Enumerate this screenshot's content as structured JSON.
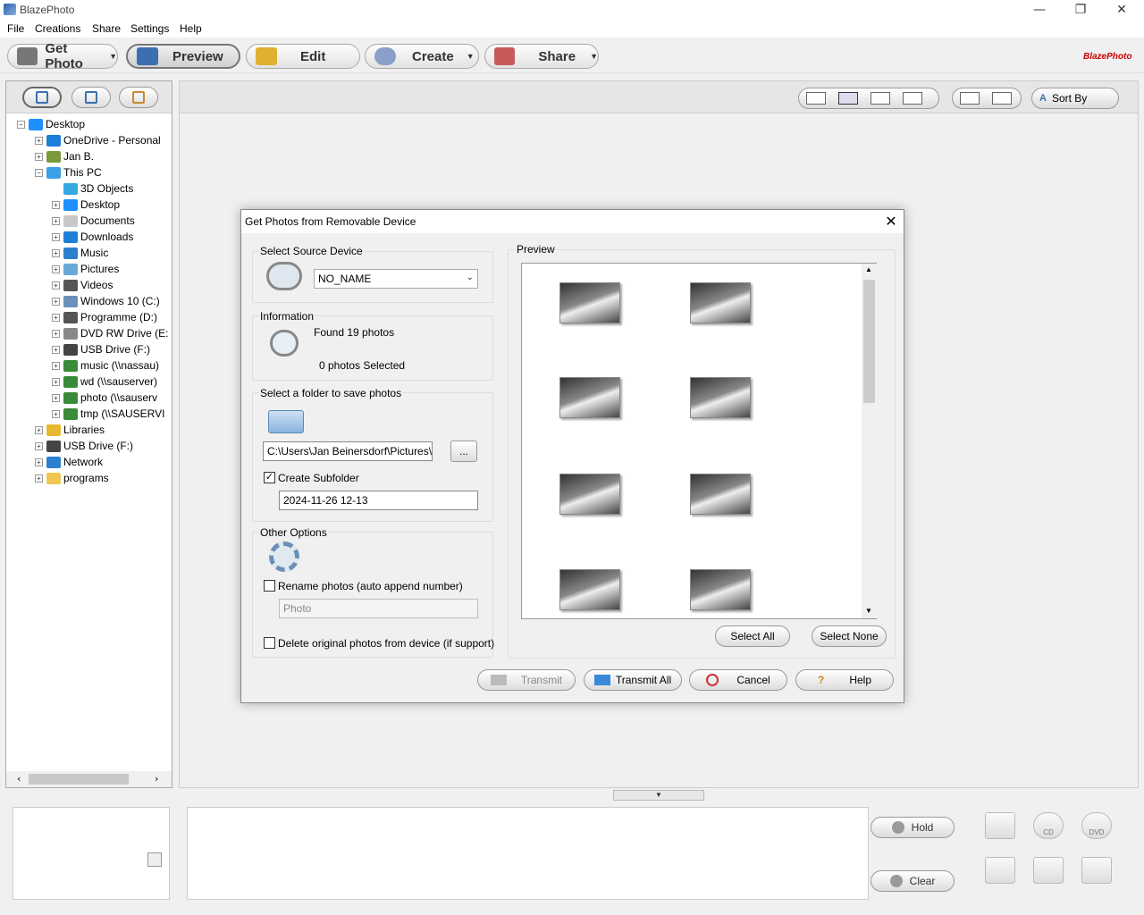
{
  "window": {
    "title": "BlazePhoto",
    "minimize": "—",
    "maximize": "❐",
    "close": "✕"
  },
  "menu": [
    "File",
    "Creations",
    "Share",
    "Settings",
    "Help"
  ],
  "toolbar": {
    "get_photo": "Get Photo",
    "preview": "Preview",
    "edit": "Edit",
    "create": "Create",
    "share": "Share",
    "dropdown_glyph": "▼",
    "logo": "BlazePhoto"
  },
  "tree": [
    {
      "label": "Desktop",
      "level": 0,
      "exp": "−",
      "icon": "desktop-icon",
      "color": "#1e90ff"
    },
    {
      "label": "OneDrive - Personal",
      "level": 1,
      "exp": "+",
      "icon": "cloud-icon",
      "color": "#1e7fd8"
    },
    {
      "label": "Jan B.",
      "level": 1,
      "exp": "+",
      "icon": "user-icon",
      "color": "#7a9a3a"
    },
    {
      "label": "This PC",
      "level": 1,
      "exp": "−",
      "icon": "computer-icon",
      "color": "#3aa0e8"
    },
    {
      "label": "3D Objects",
      "level": 2,
      "exp": "",
      "icon": "cube-icon",
      "color": "#35a8e0"
    },
    {
      "label": "Desktop",
      "level": 2,
      "exp": "+",
      "icon": "desktop-icon",
      "color": "#1e90ff"
    },
    {
      "label": "Documents",
      "level": 2,
      "exp": "+",
      "icon": "document-icon",
      "color": "#c8c8c8"
    },
    {
      "label": "Downloads",
      "level": 2,
      "exp": "+",
      "icon": "download-icon",
      "color": "#1e7fd8"
    },
    {
      "label": "Music",
      "level": 2,
      "exp": "+",
      "icon": "music-icon",
      "color": "#2d7fd0"
    },
    {
      "label": "Pictures",
      "level": 2,
      "exp": "+",
      "icon": "pictures-icon",
      "color": "#6aa8d8"
    },
    {
      "label": "Videos",
      "level": 2,
      "exp": "+",
      "icon": "video-icon",
      "color": "#555555"
    },
    {
      "label": "Windows 10 (C:)",
      "level": 2,
      "exp": "+",
      "icon": "drive-icon",
      "color": "#6a8fb8"
    },
    {
      "label": "Programme (D:)",
      "level": 2,
      "exp": "+",
      "icon": "drive-icon",
      "color": "#555555"
    },
    {
      "label": "DVD RW Drive (E:",
      "level": 2,
      "exp": "+",
      "icon": "dvd-drive-icon",
      "color": "#888888"
    },
    {
      "label": "USB Drive (F:)",
      "level": 2,
      "exp": "+",
      "icon": "usb-drive-icon",
      "color": "#444444"
    },
    {
      "label": "music (\\\\nassau)",
      "level": 2,
      "exp": "+",
      "icon": "network-drive-icon",
      "color": "#3a8a3a"
    },
    {
      "label": "wd (\\\\sauserver)",
      "level": 2,
      "exp": "+",
      "icon": "network-drive-icon",
      "color": "#3a8a3a"
    },
    {
      "label": "photo (\\\\sauserv",
      "level": 2,
      "exp": "+",
      "icon": "network-drive-icon",
      "color": "#3a8a3a"
    },
    {
      "label": "tmp (\\\\SAUSERVI",
      "level": 2,
      "exp": "+",
      "icon": "network-drive-icon",
      "color": "#3a8a3a"
    },
    {
      "label": "Libraries",
      "level": 1,
      "exp": "+",
      "icon": "library-icon",
      "color": "#e8b830"
    },
    {
      "label": "USB Drive (F:)",
      "level": 1,
      "exp": "+",
      "icon": "usb-drive-icon",
      "color": "#444444"
    },
    {
      "label": "Network",
      "level": 1,
      "exp": "+",
      "icon": "network-icon",
      "color": "#2d7fd0"
    },
    {
      "label": "programs",
      "level": 1,
      "exp": "+",
      "icon": "folder-icon",
      "color": "#f0c850"
    }
  ],
  "viewbar": {
    "sort_by": "Sort By"
  },
  "bottom": {
    "hold": "Hold",
    "clear": "Clear",
    "cd": "CD",
    "dvd": "DVD",
    "splitter_glyph": "▼"
  },
  "dialog": {
    "title": "Get Photos from Removable Device",
    "close": "✕",
    "source": {
      "label": "Select Source Device",
      "value": "NO_NAME",
      "dropdown_glyph": "⌄"
    },
    "info": {
      "label": "Information",
      "found": "Found 19 photos",
      "selected": "0 photos Selected"
    },
    "folder": {
      "label": "Select a folder to save photos",
      "path": "C:\\Users\\Jan Beinersdorf\\Pictures\\",
      "browse": "...",
      "create_subfolder": "Create Subfolder",
      "create_subfolder_checked": "✓",
      "subfolder_value": "2024-11-26 12-13"
    },
    "options": {
      "label": "Other Options",
      "rename": "Rename photos (auto append number)",
      "rename_placeholder": "Photo",
      "delete": "Delete original photos from device (if support)"
    },
    "preview_label": "Preview",
    "select_all": "Select All",
    "select_none": "Select None",
    "scroll_up": "▲",
    "scroll_down": "▼",
    "buttons": {
      "transmit": "Transmit",
      "transmit_all": "Transmit All",
      "cancel": "Cancel",
      "help": "Help"
    }
  },
  "colors": {
    "accent": "#3a6fb0",
    "window_bg": "#f0f0f0"
  }
}
